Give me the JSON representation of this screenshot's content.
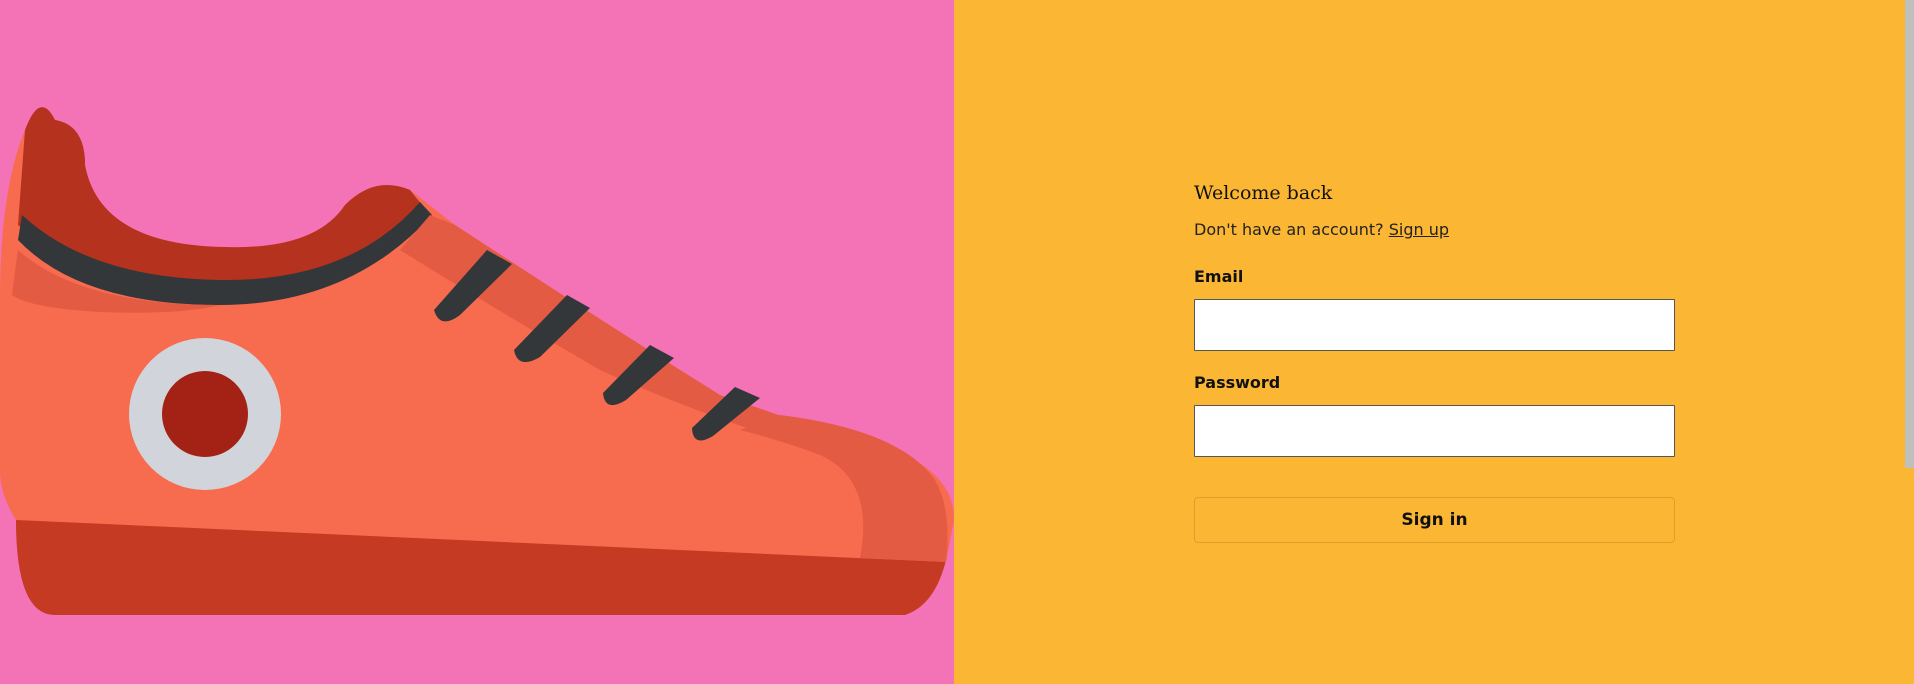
{
  "hero": {
    "illustration": "sneaker-illustration",
    "background_color": "#f472b6"
  },
  "form": {
    "heading": "Welcome back",
    "signup_prompt": "Don't have an account?",
    "signup_link": "Sign up",
    "email_label": "Email",
    "email_value": "",
    "password_label": "Password",
    "password_value": "",
    "submit_label": "Sign in"
  },
  "colors": {
    "panel_background": "#fbb634",
    "shoe_body": "#f76c4f",
    "shoe_sole": "#c43a22",
    "shoe_dark": "#b5321f",
    "laces": "#33373a"
  }
}
